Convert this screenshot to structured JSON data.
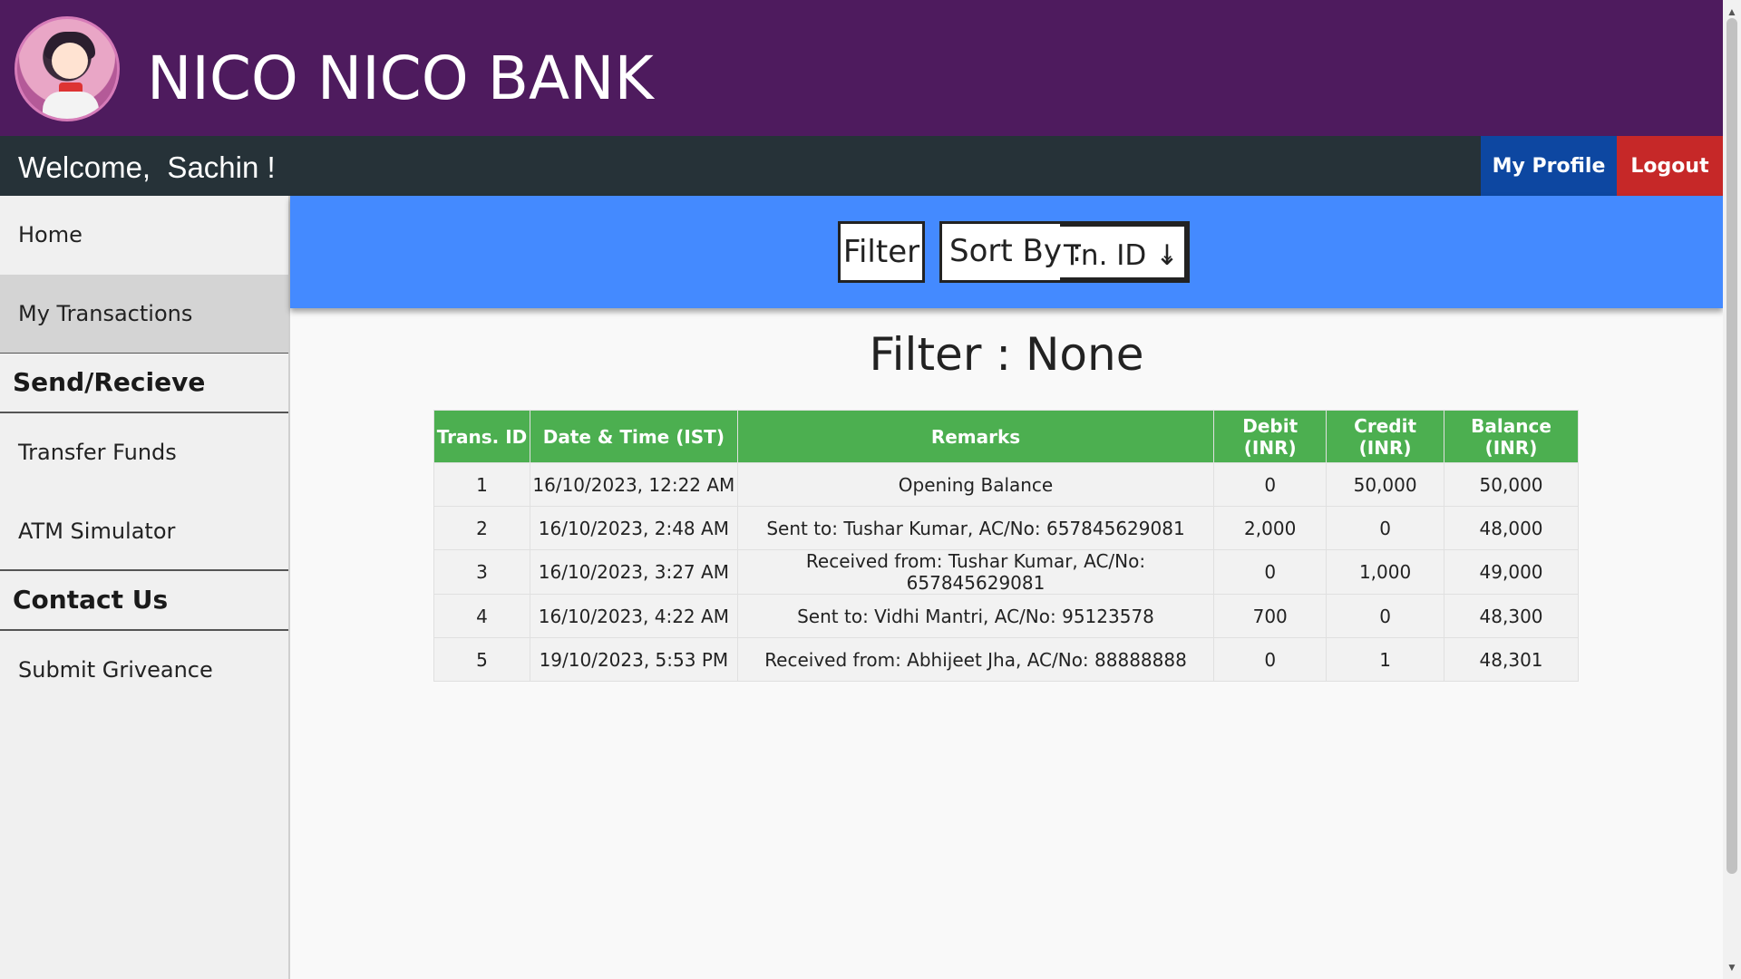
{
  "header": {
    "title": "NICO NICO BANK",
    "logo_icon": "avatar-logo"
  },
  "topbar": {
    "welcome": "Welcome,  Sachin !",
    "profile_label": "My Profile",
    "logout_label": "Logout"
  },
  "sidebar": {
    "items": [
      {
        "label": "Home"
      },
      {
        "label": "My Transactions"
      }
    ],
    "sections": [
      {
        "title": "Send/Recieve",
        "items": [
          {
            "label": "Transfer Funds"
          },
          {
            "label": "ATM Simulator"
          }
        ]
      },
      {
        "title": "Contact Us",
        "items": [
          {
            "label": "Submit Griveance"
          }
        ]
      }
    ]
  },
  "controls": {
    "filter_label": "Filter",
    "sort_label": "Sort By :",
    "sort_value": "Tn. ID ↓"
  },
  "filter_title": "Filter : None",
  "table": {
    "headers": [
      "Trans. ID",
      "Date & Time (IST)",
      "Remarks",
      "Debit (INR)",
      "Credit (INR)",
      "Balance (INR)"
    ],
    "rows": [
      [
        "1",
        "16/10/2023, 12:22 AM",
        "Opening Balance",
        "0",
        "50,000",
        "50,000"
      ],
      [
        "2",
        "16/10/2023, 2:48 AM",
        "Sent to: Tushar Kumar, AC/No: 657845629081",
        "2,000",
        "0",
        "48,000"
      ],
      [
        "3",
        "16/10/2023, 3:27 AM",
        "Received from: Tushar Kumar, AC/No: 657845629081",
        "0",
        "1,000",
        "49,000"
      ],
      [
        "4",
        "16/10/2023, 4:22 AM",
        "Sent to: Vidhi Mantri, AC/No: 95123578",
        "700",
        "0",
        "48,300"
      ],
      [
        "5",
        "19/10/2023, 5:53 PM",
        "Received from: Abhijeet Jha, AC/No: 88888888",
        "0",
        "1",
        "48,301"
      ]
    ]
  },
  "colors": {
    "header_bg": "#4e1b5e",
    "topbar_bg": "#263238",
    "profile_btn": "#0d47a1",
    "logout_btn": "#c62828",
    "controls_bg": "#448aff",
    "table_header": "#4caf50"
  }
}
